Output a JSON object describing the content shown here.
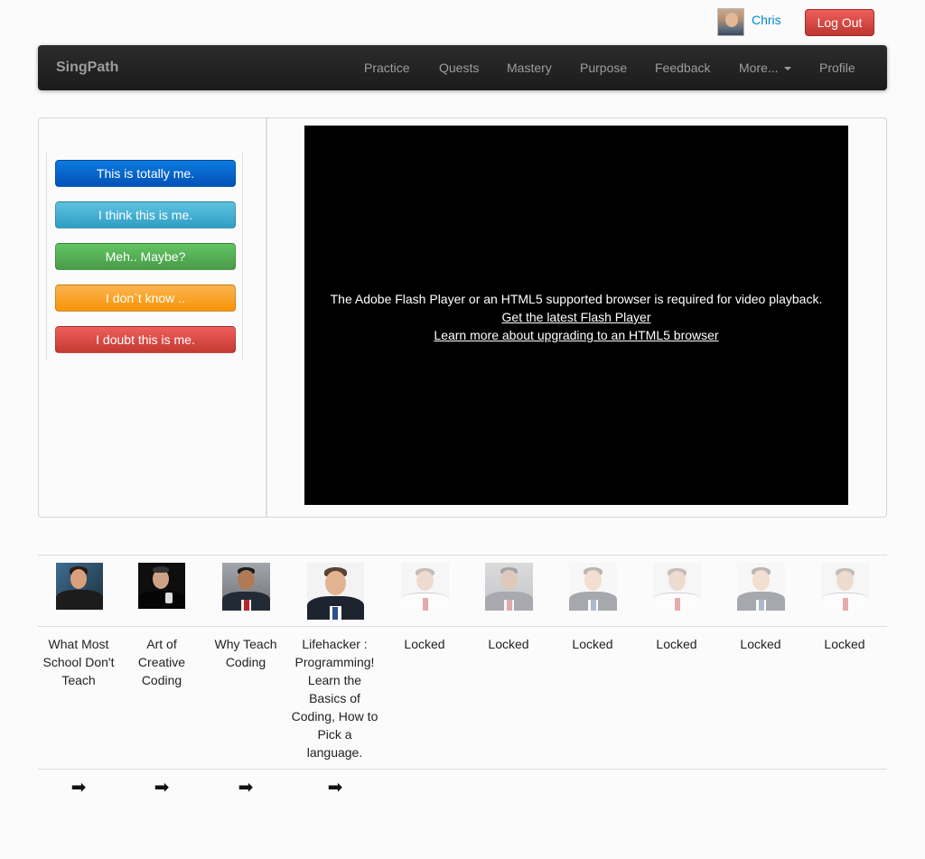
{
  "user": {
    "name": "Chris",
    "logout_label": "Log Out"
  },
  "navbar": {
    "brand": "SingPath",
    "items": [
      "Practice",
      "Quests",
      "Mastery",
      "Purpose",
      "Feedback",
      "More...",
      "Profile"
    ]
  },
  "choices": [
    "This is totally me.",
    "I think this is me.",
    "Meh.. Maybe?",
    "I don`t know ..",
    "I doubt this is me."
  ],
  "video": {
    "message": "The Adobe Flash Player or an HTML5 supported browser is required for video playback.",
    "link_flash": "Get the latest Flash Player",
    "link_html5": "Learn more about upgrading to an HTML5 browser"
  },
  "lessons": [
    {
      "title": "What Most School Don't Teach",
      "locked": false
    },
    {
      "title": "Art of Creative Coding",
      "locked": false
    },
    {
      "title": "Why Teach Coding",
      "locked": false
    },
    {
      "title": "Lifehacker : Programming! Learn the Basics of Coding, How to Pick a language.",
      "locked": false
    },
    {
      "title": "Locked",
      "locked": true
    },
    {
      "title": "Locked",
      "locked": true
    },
    {
      "title": "Locked",
      "locked": true
    },
    {
      "title": "Locked",
      "locked": true
    },
    {
      "title": "Locked",
      "locked": true
    },
    {
      "title": "Locked",
      "locked": true
    }
  ],
  "icons": {
    "arrow": "arrow-right-icon",
    "caret": "caret-down-icon"
  },
  "colors": {
    "link": "#0088cc",
    "navbar": "#1b1b1b",
    "danger": "#bd362f"
  }
}
